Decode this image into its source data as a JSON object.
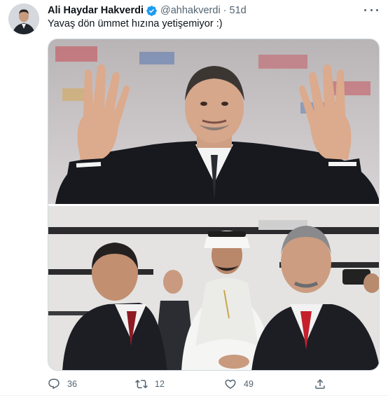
{
  "tweet": {
    "author_name": "Ali Haydar Hakverdi",
    "handle": "@ahhakverdi",
    "separator": "·",
    "time": "51d",
    "text": "Yavaş dön ümmet hızına yetişemiyor :)",
    "verified": true
  },
  "actions": {
    "reply_count": "36",
    "retweet_count": "12",
    "like_count": "49"
  },
  "icons": {
    "verified": "verified-badge-icon",
    "more": "more-options-icon",
    "reply": "reply-icon",
    "retweet": "retweet-icon",
    "like": "heart-icon",
    "share": "share-icon"
  },
  "colors": {
    "verified_blue": "#1d9bf0",
    "secondary_text": "#536471",
    "primary_text": "#0f1419"
  }
}
